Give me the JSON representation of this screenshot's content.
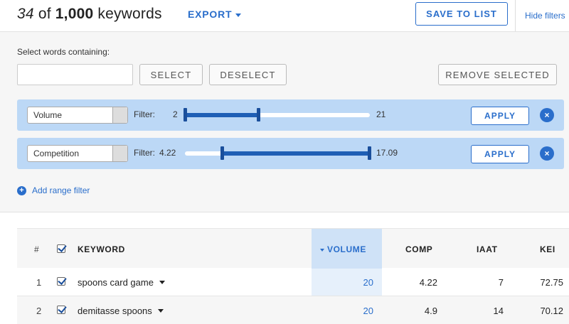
{
  "header": {
    "count_shown": "34",
    "count_of": "of",
    "count_total": "1,000",
    "count_unit": "keywords",
    "export_label": "EXPORT",
    "save_label": "SAVE TO LIST",
    "hide_filters_label": "Hide filters"
  },
  "filters": {
    "select_label": "Select words containing:",
    "input_value": "",
    "select_btn": "SELECT",
    "deselect_btn": "DESELECT",
    "remove_btn": "REMOVE SELECTED",
    "rows": [
      {
        "metric": "Volume",
        "filter_label": "Filter:",
        "min": "2",
        "max": "21",
        "range_low": 0,
        "range_high": 0.4,
        "apply": "APPLY",
        "close_icon": "×"
      },
      {
        "metric": "Competition",
        "filter_label": "Filter:",
        "min": "4.22",
        "max": "17.09",
        "range_low": 0.2,
        "range_high": 1.0,
        "apply": "APPLY",
        "close_icon": "×"
      }
    ],
    "add_range_label": "Add range filter",
    "add_icon": "+"
  },
  "table": {
    "headers": {
      "num": "#",
      "keyword": "KEYWORD",
      "volume": "VOLUME",
      "comp": "COMP",
      "iaat": "IAAT",
      "kei": "KEI"
    },
    "sort_column": "volume",
    "rows": [
      {
        "num": "1",
        "keyword": "spoons card game",
        "volume": "20",
        "comp": "4.22",
        "iaat": "7",
        "kei": "72.75",
        "checked": true
      },
      {
        "num": "2",
        "keyword": "demitasse spoons",
        "volume": "20",
        "comp": "4.9",
        "iaat": "14",
        "kei": "70.12",
        "checked": true
      }
    ]
  },
  "colors": {
    "accent": "#2a6ecb",
    "filter_row_bg": "#bcd8f6",
    "slider_fill": "#1f5fb5"
  }
}
